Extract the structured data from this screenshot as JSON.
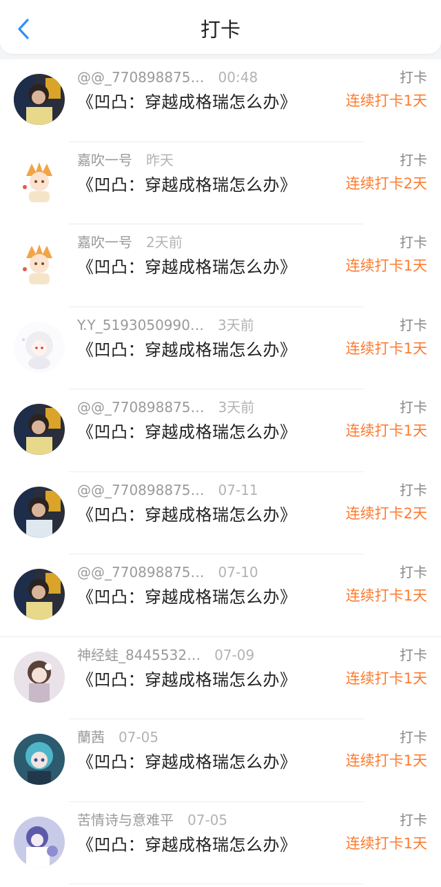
{
  "header": {
    "title": "打卡"
  },
  "colors": {
    "accent": "#2f8ef5",
    "streak": "#ff7a2e"
  },
  "rows": [
    {
      "user": "@@_770898875…",
      "time": "00:48",
      "book": "《凹凸：穿越成格瑞怎么办》",
      "action": "打卡",
      "streak": "连续打卡1天",
      "avatar": "avatar-dark-photo"
    },
    {
      "user": "嘉吹一号",
      "time": "昨天",
      "book": "《凹凸：穿越成格瑞怎么办》",
      "action": "打卡",
      "streak": "连续打卡2天",
      "avatar": "avatar-anime-orange"
    },
    {
      "user": "嘉吹一号",
      "time": "2天前",
      "book": "《凹凸：穿越成格瑞怎么办》",
      "action": "打卡",
      "streak": "连续打卡1天",
      "avatar": "avatar-anime-orange"
    },
    {
      "user": "Y.Y_5193050990…",
      "time": "3天前",
      "book": "《凹凸：穿越成格瑞怎么办》",
      "action": "打卡",
      "streak": "连续打卡1天",
      "avatar": "avatar-anime-white"
    },
    {
      "user": "@@_770898875…",
      "time": "3天前",
      "book": "《凹凸：穿越成格瑞怎么办》",
      "action": "打卡",
      "streak": "连续打卡1天",
      "avatar": "avatar-dark-photo"
    },
    {
      "user": "@@_770898875…",
      "time": "07-11",
      "book": "《凹凸：穿越成格瑞怎么办》",
      "action": "打卡",
      "streak": "连续打卡2天",
      "avatar": "avatar-dark-photo"
    },
    {
      "user": "@@_770898875…",
      "time": "07-10",
      "book": "《凹凸：穿越成格瑞怎么办》",
      "action": "打卡",
      "streak": "连续打卡1天",
      "avatar": "avatar-dark-photo"
    },
    {
      "user": "神经蛙_8445532…",
      "time": "07-09",
      "book": "《凹凸：穿越成格瑞怎么办》",
      "action": "打卡",
      "streak": "连续打卡1天",
      "avatar": "avatar-girl-illustration"
    },
    {
      "user": "蘭茜",
      "time": "07-05",
      "book": "《凹凸：穿越成格瑞怎么办》",
      "action": "打卡",
      "streak": "连续打卡1天",
      "avatar": "avatar-anime-blue"
    },
    {
      "user": "苦情诗与意难平",
      "time": "07-05",
      "book": "《凹凸：穿越成格瑞怎么办》",
      "action": "打卡",
      "streak": "连续打卡1天",
      "avatar": "avatar-anime-purple"
    }
  ]
}
